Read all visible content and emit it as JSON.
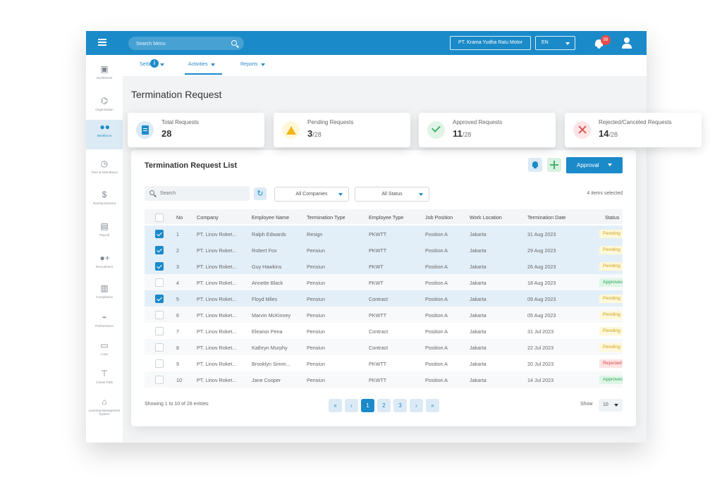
{
  "topbar": {
    "search_placeholder": "Search Menu",
    "company": "PT. Krama Yudha Ratu Motor",
    "language": "EN",
    "notification_count": "99"
  },
  "sidebar": {
    "items": [
      {
        "label": "Workbench",
        "icon": "briefcase-icon"
      },
      {
        "label": "Organization",
        "icon": "organization-icon"
      },
      {
        "label": "Workforce",
        "icon": "people-icon"
      },
      {
        "label": "Time & Attendance",
        "icon": "clock-icon"
      },
      {
        "label": "Reimbursement",
        "icon": "money-hand-icon"
      },
      {
        "label": "Payroll",
        "icon": "payroll-icon"
      },
      {
        "label": "Recruitment",
        "icon": "add-person-icon"
      },
      {
        "label": "Compliance",
        "icon": "bar-chart-icon"
      },
      {
        "label": "Performance",
        "icon": "trend-chart-icon"
      },
      {
        "label": "Loan",
        "icon": "card-icon"
      },
      {
        "label": "Career Path",
        "icon": "signpost-icon"
      },
      {
        "label": "Learning Management System",
        "icon": "graduation-icon"
      }
    ]
  },
  "subnav": {
    "items": [
      "Settings",
      "Activities",
      "Reports"
    ]
  },
  "page": {
    "title": "Termination Request"
  },
  "stats": [
    {
      "label": "Total Requests",
      "value": "28",
      "total": ""
    },
    {
      "label": "Pending Requests",
      "value": "3",
      "total": "/28"
    },
    {
      "label": "Approved Requests",
      "value": "11",
      "total": "/28"
    },
    {
      "label": "Rejected/Canceled Requests",
      "value": "14",
      "total": "/28"
    }
  ],
  "list": {
    "title": "Termination Request List",
    "approval_label": "Approval",
    "search_placeholder": "Search",
    "company_filter": "All Companies",
    "status_filter": "All Status",
    "items_selected": "4 items selected",
    "columns": [
      "No",
      "Company",
      "Employee Name",
      "Termination Type",
      "Employee Type",
      "Job Position",
      "Work Location",
      "Termination Date",
      "Status"
    ],
    "rows": [
      {
        "no": "1",
        "company": "PT. Linov Roket...",
        "name": "Ralph Edwards",
        "type": "Resign",
        "emp": "PKWTT",
        "position": "Position A",
        "location": "Jakarta",
        "date": "31 Aug 2023",
        "status": "Pending",
        "checked": true
      },
      {
        "no": "2",
        "company": "PT. Linov Roket...",
        "name": "Robert Fox",
        "type": "Pensiun",
        "emp": "PKWTT",
        "position": "Position A",
        "location": "Jakarta",
        "date": "29 Aug 2023",
        "status": "Pending",
        "checked": true
      },
      {
        "no": "3",
        "company": "PT. Linov Roket...",
        "name": "Guy Hawkins",
        "type": "Pensiun",
        "emp": "PKWT",
        "position": "Position A",
        "location": "Jakarta",
        "date": "26 Aug 2023",
        "status": "Pending",
        "checked": true
      },
      {
        "no": "4",
        "company": "PT. Linov Roket...",
        "name": "Annette Black",
        "type": "Pensiun",
        "emp": "PKWT",
        "position": "Position A",
        "location": "Jakarta",
        "date": "18 Aug 2023",
        "status": "Approved",
        "checked": false
      },
      {
        "no": "5",
        "company": "PT. Linov Roket...",
        "name": "Floyd Miles",
        "type": "Pensiun",
        "emp": "Contract",
        "position": "Position A",
        "location": "Jakarta",
        "date": "09 Aug 2023",
        "status": "Pending",
        "checked": true
      },
      {
        "no": "6",
        "company": "PT. Linov Roket...",
        "name": "Marvin McKinney",
        "type": "Pensiun",
        "emp": "PKWTT",
        "position": "Position A",
        "location": "Jakarta",
        "date": "05 Aug 2023",
        "status": "Pending",
        "checked": false
      },
      {
        "no": "7",
        "company": "PT. Linov Roket...",
        "name": "Eleanor Pena",
        "type": "Pensiun",
        "emp": "Contract",
        "position": "Position A",
        "location": "Jakarta",
        "date": "31 Jul 2023",
        "status": "Pending",
        "checked": false
      },
      {
        "no": "8",
        "company": "PT. Linov Roket...",
        "name": "Kathryn Murphy",
        "type": "Pensiun",
        "emp": "Contract",
        "position": "Position A",
        "location": "Jakarta",
        "date": "22 Jul 2023",
        "status": "Pending",
        "checked": false
      },
      {
        "no": "9",
        "company": "PT. Linov Roket...",
        "name": "Brooklyn Simm...",
        "type": "Pensiun",
        "emp": "PKWTT",
        "position": "Position A",
        "location": "Jakarta",
        "date": "20 Jul 2023",
        "status": "Rejected",
        "checked": false
      },
      {
        "no": "10",
        "company": "PT. Linov Roket...",
        "name": "Jane Cooper",
        "type": "Pensiun",
        "emp": "PKWTT",
        "position": "Position A",
        "location": "Jakarta",
        "date": "14 Jul 2023",
        "status": "Approved",
        "checked": false
      }
    ]
  },
  "pagination": {
    "summary": "Showing 1 to 10 of 28 entries",
    "pages": [
      "1",
      "2",
      "3"
    ],
    "current": "1",
    "first": "«",
    "prev": "‹",
    "next": "›",
    "last": "»",
    "show_label": "Show",
    "page_size": "10"
  }
}
